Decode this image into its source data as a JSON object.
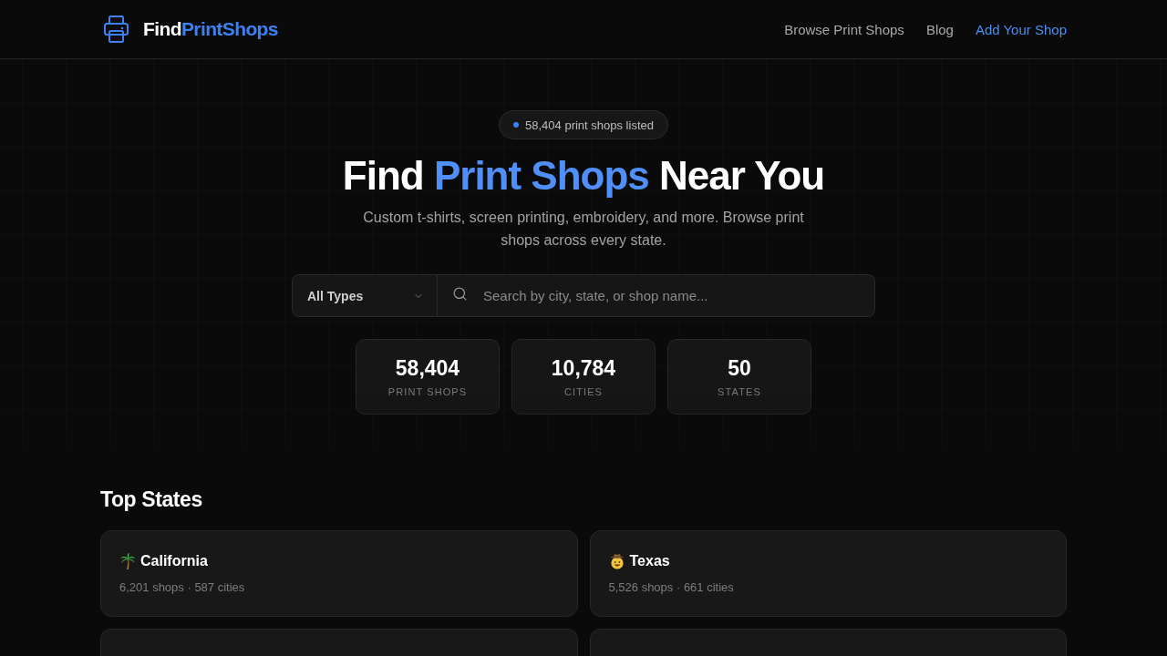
{
  "header": {
    "logo": [
      {
        "text": "Find",
        "highlight": false
      },
      {
        "text": "PrintShops",
        "highlight": true
      }
    ],
    "nav": [
      {
        "label": "Browse Print Shops",
        "kind": "link"
      },
      {
        "label": "Blog",
        "kind": "link"
      },
      {
        "label": "Add Your Shop",
        "kind": "cta"
      }
    ]
  },
  "hero": {
    "badge": "58,404 print shops listed",
    "heading": [
      {
        "text": "Find",
        "highlight": false
      },
      {
        "text": "Print Shops",
        "highlight": true
      },
      {
        "text": "Near You",
        "highlight": false
      }
    ],
    "subtitle": "Custom t-shirts, screen printing, embroidery, and more. Browse print shops across every state.",
    "search": {
      "type_filter": "All Types",
      "placeholder": "Search by city, state, or shop name..."
    },
    "stats": [
      {
        "value": "58,404",
        "label": "PRINT SHOPS"
      },
      {
        "value": "10,784",
        "label": "CITIES"
      },
      {
        "value": "50",
        "label": "STATES"
      }
    ]
  },
  "top_states": {
    "title": "Top States",
    "states": [
      {
        "kind": "full",
        "name": "California",
        "stats": "6,201 shops · 587 cities"
      },
      {
        "kind": "full",
        "name": "Texas",
        "stats": "5,526 shops · 661 cities"
      },
      {
        "kind": "cut_off"
      },
      {
        "kind": "cut_off"
      }
    ]
  }
}
